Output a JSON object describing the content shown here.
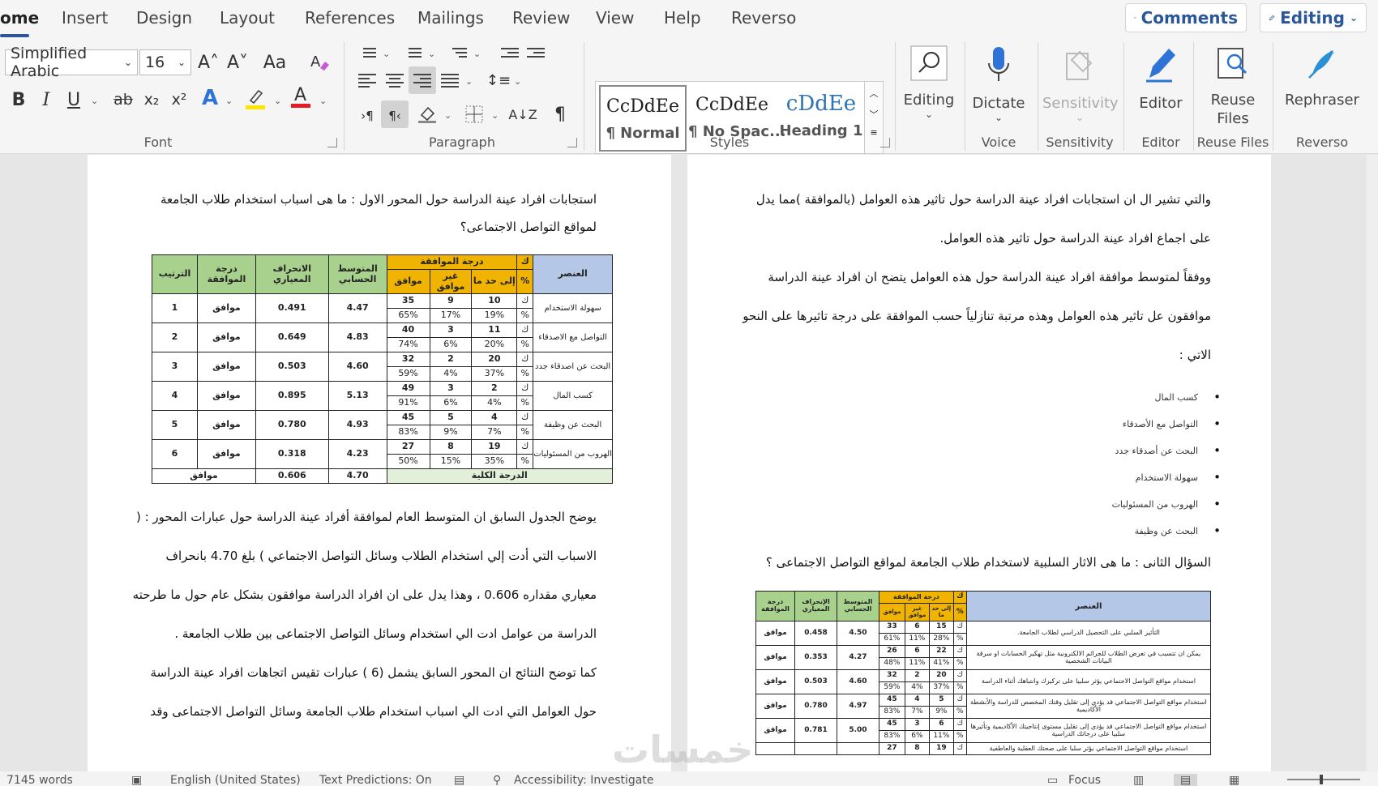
{
  "tabs": [
    "ome",
    "Insert",
    "Design",
    "Layout",
    "References",
    "Mailings",
    "Review",
    "View",
    "Help",
    "Reverso"
  ],
  "top_buttons": {
    "comments": "Comments",
    "editing": "Editing"
  },
  "font": {
    "name": "Simplified Arabic",
    "size": "16",
    "grow": "A˄",
    "shrink": "A˅",
    "case": "Aa",
    "bold": "B",
    "italic": "I",
    "underline": "U",
    "strike": "ab",
    "sub": "x₂",
    "sup": "x²",
    "effects": "A",
    "color": "A"
  },
  "groups": {
    "font": "Font",
    "paragraph": "Paragraph",
    "styles": "Styles",
    "voice": "Voice",
    "sensitivity": "Sensitivity",
    "editor": "Editor",
    "reuse": "Reuse Files",
    "reverso": "Reverso"
  },
  "styles": [
    {
      "preview": "CcDdEe",
      "name": "¶ Normal"
    },
    {
      "preview": "CcDdEe",
      "name": "¶ No Spac..."
    },
    {
      "preview": "cDdEe",
      "name": "Heading 1"
    }
  ],
  "big_buttons": {
    "editing": "Editing",
    "dictate": "Dictate",
    "sensitivity": "Sensitivity",
    "editor": "Editor",
    "reuse1": "Reuse",
    "reuse2": "Files",
    "rephraser": "Rephraser"
  },
  "colors": {
    "accent": "#2b579a",
    "highlight": "#ffe600",
    "font_color": "#e31c23",
    "effects": "#2e74d6"
  },
  "left_page": {
    "heading1": "استجابات افراد عينة الدراسة حول المحور الاول : ما هى اسباب استخدام طلاب الجامعة",
    "heading2": "لمواقع التواصل الاجتماعى؟",
    "table": {
      "headers": {
        "item": "العنصر",
        "sign": "ك",
        "pct": "%",
        "agreement": "درجة الموافقة",
        "to_extent": "إلى حد ما",
        "disagree": "غير موافق",
        "agree": "موافق",
        "mean": "المتوسط الحسابي",
        "sd": "الانحراف المعياري",
        "degree": "درجة الموافقة",
        "rank": "الترتيب"
      },
      "rows": [
        {
          "item": "سهولة الاستخدام",
          "k": [
            "10",
            "9",
            "35"
          ],
          "p": [
            "19%",
            "17%",
            "65%"
          ],
          "mean": "4.47",
          "sd": "0.491",
          "deg": "موافق",
          "rank": "1"
        },
        {
          "item": "التواصل مع الاصدقاء",
          "k": [
            "11",
            "3",
            "40"
          ],
          "p": [
            "20%",
            "6%",
            "74%"
          ],
          "mean": "4.83",
          "sd": "0.649",
          "deg": "موافق",
          "rank": "2"
        },
        {
          "item": "البحث عن اصدقاء جدد",
          "k": [
            "20",
            "2",
            "32"
          ],
          "p": [
            "37%",
            "4%",
            "59%"
          ],
          "mean": "4.60",
          "sd": "0.503",
          "deg": "موافق",
          "rank": "3"
        },
        {
          "item": "كسب المال",
          "k": [
            "2",
            "3",
            "49"
          ],
          "p": [
            "4%",
            "6%",
            "91%"
          ],
          "mean": "5.13",
          "sd": "0.895",
          "deg": "موافق",
          "rank": "4"
        },
        {
          "item": "البحث عن وظيفة",
          "k": [
            "4",
            "5",
            "45"
          ],
          "p": [
            "7%",
            "9%",
            "83%"
          ],
          "mean": "4.93",
          "sd": "0.780",
          "deg": "موافق",
          "rank": "5"
        },
        {
          "item": "الهروب من المسئوليات",
          "k": [
            "19",
            "8",
            "27"
          ],
          "p": [
            "35%",
            "15%",
            "50%"
          ],
          "mean": "4.23",
          "sd": "0.318",
          "deg": "موافق",
          "rank": "6"
        }
      ],
      "total_label": "الدرجة الكلية",
      "total_mean": "4.70",
      "total_sd": "0.606",
      "total_deg": "موافق"
    },
    "paras": [
      "يوضح الجدول السابق ان المتوسط العام لموافقة أفراد عينة الدراسة حول عبارات المحور : (",
      "الاسباب التي أدت إلي استخدام الطلاب وسائل التواصل الاجتماعي ) بلغ 4.70 بانحراف",
      "معياري مقداره 0.606 ، وهذا يدل على ان افراد الدراسة موافقون بشكل عام حول ما طرحته",
      "الدراسة من عوامل ادت الي استخدام وسائل التواصل الاجتماعى بين طلاب الجامعة .",
      "كما توضح النتائج ان المحور السابق يشمل (6 ) عبارات تقيس اتجاهات افراد عينة الدراسة",
      "حول العوامل التي ادت الي اسباب استخدام طلاب الجامعة وسائل التواصل الاجتماعى وقد"
    ]
  },
  "right_page": {
    "paras": [
      "والتي تشير ال ان استجابات افراد عينة الدراسة حول تاثير هذه العوامل (بالموافقة )مما يدل",
      "على اجماع افراد عينة الدراسة حول تاثير هذه العوامل.",
      "ووفقاً لمتوسط موافقة افراد عينة الدراسة حول هذه العوامل يتضح ان افراد عينة الدراسة",
      "موافقون عل تاثير هذه العوامل وهذه مرتبة تنازلياً حسب الموافقة على درجة تاثيرها على النحو",
      "الاتي :"
    ],
    "bullets": [
      "كسب المال",
      "التواصل مع الأصدقاء",
      "البحث عن أصدقاء جدد",
      "سهولة الاستخدام",
      "الهروب من المسئوليات",
      "البحث عن وظيفة"
    ],
    "question": "السؤال الثانى : ما هى الاثار السلبية لاستخدام طلاب الجامعة لمواقع التواصل الاجتماعى ؟",
    "table": {
      "headers": {
        "item": "العنصر",
        "sign": "ك",
        "pct": "%",
        "agreement": "درجة الموافقة",
        "to_extent": "إلى حد ما",
        "disagree": "غير موافق",
        "agree": "موافق",
        "mean": "المتوسط الحسابي",
        "sd": "الإنحراف المعياري",
        "degree": "درجة الموافقة"
      },
      "rows": [
        {
          "item": "التأثير السلبي على التحصيل الدراسي لطلاب الجامعة.",
          "k": [
            "15",
            "6",
            "33"
          ],
          "p": [
            "28%",
            "11%",
            "61%"
          ],
          "mean": "4.50",
          "sd": "0.458",
          "deg": "موافق"
        },
        {
          "item": "يمكن ان تتسبب في تعرض الطلاب للجرائم الالكترونية مثل تهكير الحسابات او سرقة البيانات الشخصية",
          "k": [
            "22",
            "6",
            "26"
          ],
          "p": [
            "41%",
            "11%",
            "48%"
          ],
          "mean": "4.27",
          "sd": "0.353",
          "deg": "موافق"
        },
        {
          "item": "استخدام مواقع التواصل الاجتماعي يؤثر سلبيا على تركيزك وانتباهك أثناء الدراسة",
          "k": [
            "20",
            "2",
            "32"
          ],
          "p": [
            "37%",
            "4%",
            "59%"
          ],
          "mean": "4.60",
          "sd": "0.503",
          "deg": "موافق"
        },
        {
          "item": "استخدام مواقع التواصل الاجتماعي قد يؤدي إلى تقليل وقتك المخصص للدراسة والأنشطة الأكاديمية",
          "k": [
            "5",
            "4",
            "45"
          ],
          "p": [
            "9%",
            "7%",
            "83%"
          ],
          "mean": "4.97",
          "sd": "0.780",
          "deg": "موافق"
        },
        {
          "item": "استخدام مواقع التواصل الاجتماعي قد يؤدي إلى تقليل مستوى إنتاجيتك الأكاديمية وتأثيرها سلبيا على درجاتك الدراسية",
          "k": [
            "6",
            "3",
            "45"
          ],
          "p": [
            "11%",
            "6%",
            "83%"
          ],
          "mean": "5.00",
          "sd": "0.781",
          "deg": "موافق"
        },
        {
          "item": "استخدام مواقع التواصل الاجتماعي يؤثر سلبا على صحتك العقلية والعاطفية",
          "k": [
            "19",
            "8",
            "27"
          ],
          "p": [
            "",
            "",
            ""
          ],
          "mean": "",
          "sd": "",
          "deg": ""
        }
      ]
    }
  },
  "status": {
    "words": "7145 words",
    "language": "English (United States)",
    "predictions": "Text Predictions: On",
    "accessibility": "Accessibility: Investigate",
    "focus": "Focus"
  },
  "watermark": "خمسات"
}
